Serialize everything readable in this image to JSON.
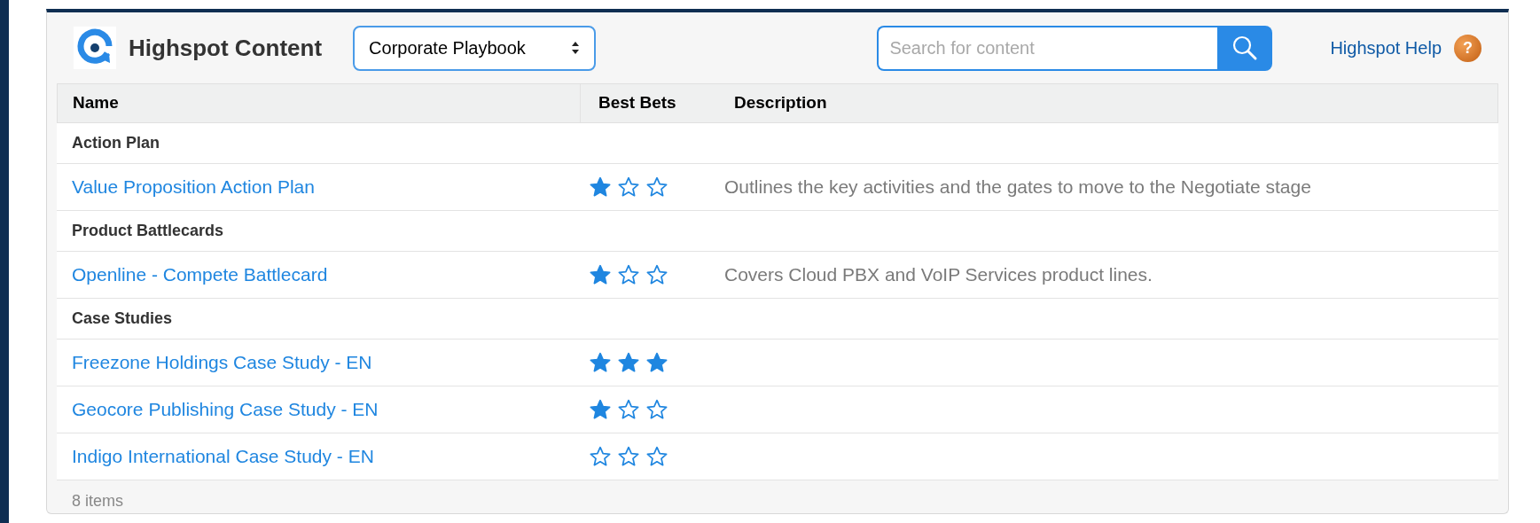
{
  "header": {
    "title": "Highspot Content",
    "playbook_select": "Corporate Playbook",
    "search": {
      "placeholder": "Search for content"
    },
    "help_link": "Highspot Help",
    "help_icon": "?"
  },
  "table": {
    "columns": [
      "Name",
      "Best Bets",
      "Description"
    ],
    "rows": [
      {
        "kind": "group",
        "name": "Action Plan"
      },
      {
        "kind": "item",
        "name": "Value Proposition Action Plan",
        "stars": 1,
        "description": "Outlines the key activities and the gates to move to the Negotiate stage"
      },
      {
        "kind": "group",
        "name": "Product Battlecards"
      },
      {
        "kind": "item",
        "name": "Openline - Compete Battlecard",
        "stars": 1,
        "description": "Covers Cloud PBX and VoIP Services product lines."
      },
      {
        "kind": "group",
        "name": "Case Studies"
      },
      {
        "kind": "item",
        "name": "Freezone Holdings Case Study - EN",
        "stars": 3
      },
      {
        "kind": "item",
        "name": "Geocore Publishing Case Study - EN",
        "stars": 1
      },
      {
        "kind": "item",
        "name": "Indigo International Case Study - EN",
        "stars": 0
      }
    ]
  },
  "status_bar": "8 items"
}
